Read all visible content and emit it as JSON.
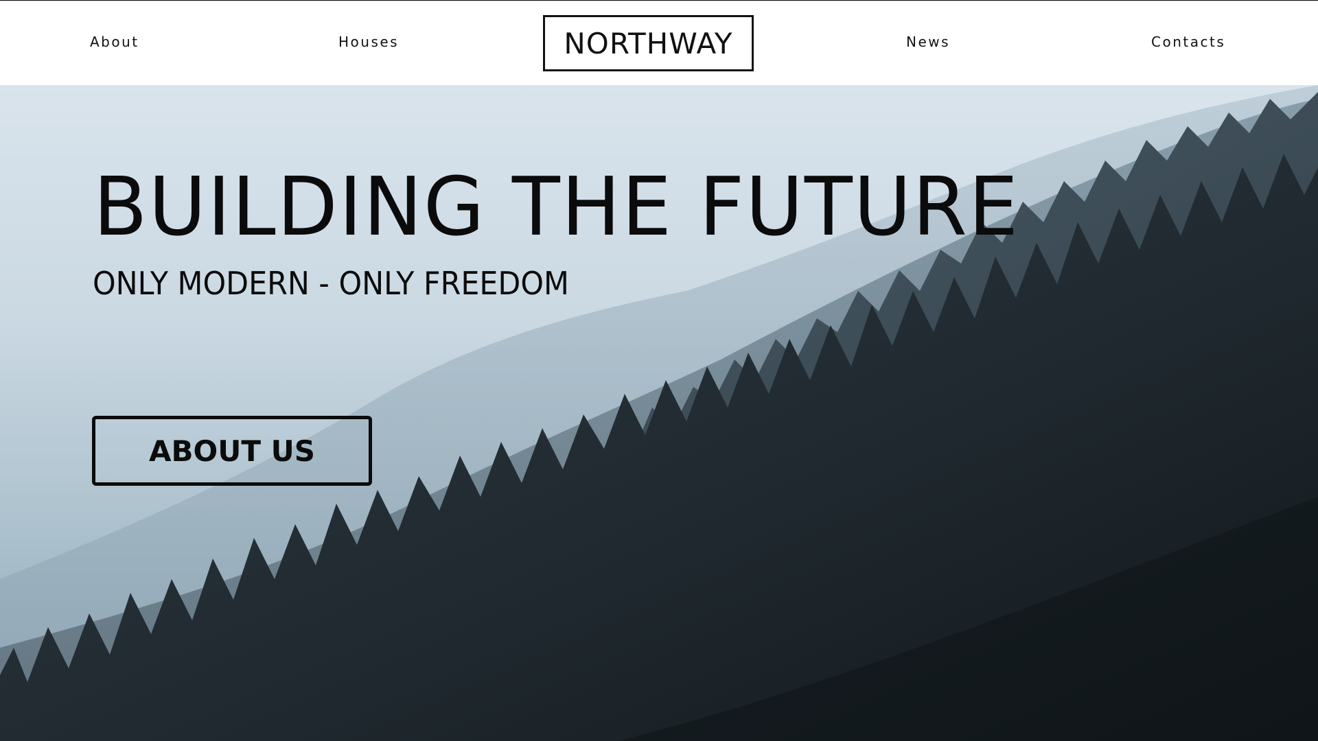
{
  "header": {
    "logo_text": "NORTHWAY",
    "nav": {
      "about": "About",
      "houses": "Houses",
      "news": "News",
      "contacts": "Contacts"
    }
  },
  "hero": {
    "title": "BUILDING THE FUTURE",
    "subtitle": "ONLY MODERN - ONLY FREEDOM",
    "cta_label": "ABOUT US"
  },
  "colors": {
    "text": "#0b0b0b",
    "header_bg": "#ffffff",
    "sky": "#d9e4ec",
    "forest_dark": "#1b2329"
  }
}
